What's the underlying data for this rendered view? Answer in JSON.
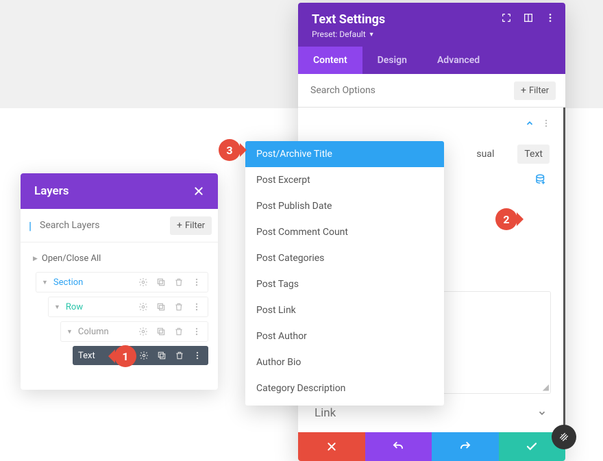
{
  "layers": {
    "title": "Layers",
    "search_placeholder": "Search Layers",
    "filter_label": "Filter",
    "open_close": "Open/Close All",
    "items": {
      "section": "Section",
      "row": "Row",
      "column": "Column",
      "text": "Text"
    }
  },
  "settings": {
    "title": "Text Settings",
    "preset": "Preset: Default",
    "tabs": {
      "content": "Content",
      "design": "Design",
      "advanced": "Advanced"
    },
    "search_placeholder": "Search Options",
    "filter_label": "Filter",
    "editor_tabs": {
      "visual": "sual",
      "text": "Text"
    },
    "link_label": "Link"
  },
  "dropdown": {
    "items": [
      "Post/Archive Title",
      "Post Excerpt",
      "Post Publish Date",
      "Post Comment Count",
      "Post Categories",
      "Post Tags",
      "Post Link",
      "Post Author",
      "Author Bio",
      "Category Description"
    ]
  },
  "callouts": {
    "c1": "1",
    "c2": "2",
    "c3": "3"
  }
}
